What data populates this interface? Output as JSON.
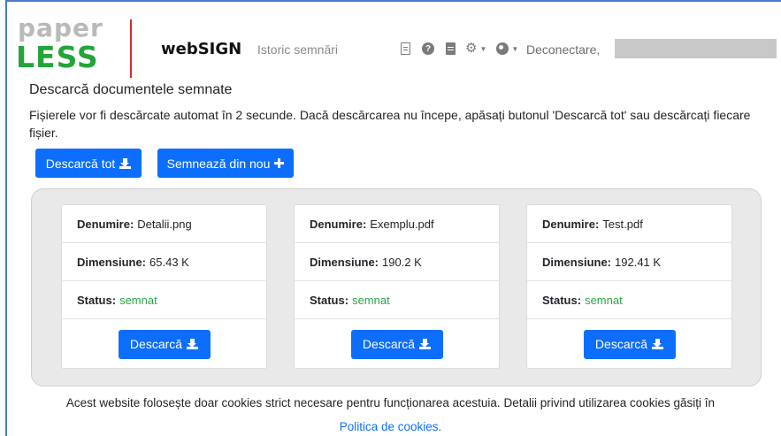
{
  "header": {
    "logo_top": "paper",
    "logo_bottom": "LESS",
    "brand": "webSIGN",
    "nav_history": "Istoric semnări",
    "logout": "Deconectare,",
    "icons": [
      "document-icon",
      "help-icon",
      "file-icon",
      "settings-icon",
      "language-icon"
    ]
  },
  "page": {
    "title": "Descarcă documentele semnate",
    "description": "Fișierele vor fi descărcate automat în 2 secunde. Dacă descărcarea nu începe, apăsați butonul 'Descarcă tot' sau descărcați fiecare fișier.",
    "download_all_label": "Descarcă tot",
    "resign_label": "Semnează din nou"
  },
  "files": [
    {
      "name_label": "Denumire:",
      "name": "Detalii.png",
      "size_label": "Dimensiune:",
      "size": "65.43 K",
      "status_label": "Status:",
      "status": "semnat",
      "download_label": "Descarcă"
    },
    {
      "name_label": "Denumire:",
      "name": "Exemplu.pdf",
      "size_label": "Dimensiune:",
      "size": "190.2 K",
      "status_label": "Status:",
      "status": "semnat",
      "download_label": "Descarcă"
    },
    {
      "name_label": "Denumire:",
      "name": "Test.pdf",
      "size_label": "Dimensiune:",
      "size": "192.41 K",
      "status_label": "Status:",
      "status": "semnat",
      "download_label": "Descarcă"
    }
  ],
  "footer": {
    "cookie_text": "Acest website folosește doar cookies strict necesare pentru funcționarea acestuia. Detalii privind utilizarea cookies găsiți în",
    "cookie_link": "Politica de cookies",
    "cookie_link_suffix": "."
  },
  "colors": {
    "primary": "#0d6efd",
    "status_ok": "#28a745",
    "logo_green": "#23a53a",
    "logo_gray": "#b9b9b9",
    "divider_red": "#d62b2b"
  }
}
